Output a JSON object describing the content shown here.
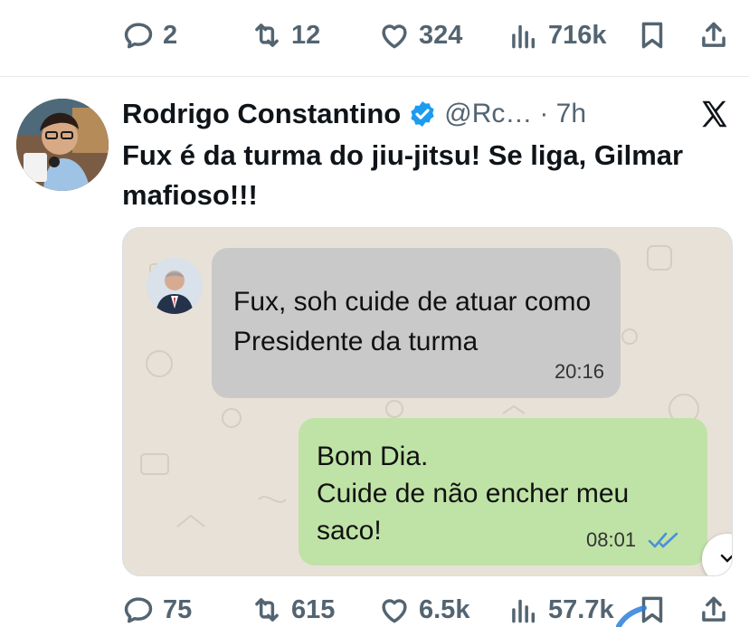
{
  "previous_tweet": {
    "actions": {
      "reply_count": "2",
      "retweet_count": "12",
      "like_count": "324",
      "view_count": "716k"
    }
  },
  "tweet": {
    "author": {
      "name": "Rodrigo Constantino",
      "handle": "@Rc…",
      "verified": true
    },
    "time": "· 7h",
    "text": "Fux é da turma do jiu-jitsu! Se liga, Gilmar mafioso!!!",
    "media": {
      "incoming_message": {
        "text": "Fux, soh cuide de atuar como Presidente da turma",
        "time": "20:16"
      },
      "outgoing_message": {
        "line1": "Bom Dia.",
        "line2": "Cuide de não encher meu saco!",
        "time": "08:01"
      }
    },
    "actions": {
      "reply_count": "75",
      "retweet_count": "615",
      "like_count": "6.5k",
      "view_count": "57.7k"
    }
  },
  "colors": {
    "verified_badge": "#1d9bf0",
    "icon_gray": "#536471",
    "incoming_bubble": "#c9c9c9",
    "outgoing_bubble": "#bfe3a6",
    "read_ticks": "#4a90d9"
  }
}
